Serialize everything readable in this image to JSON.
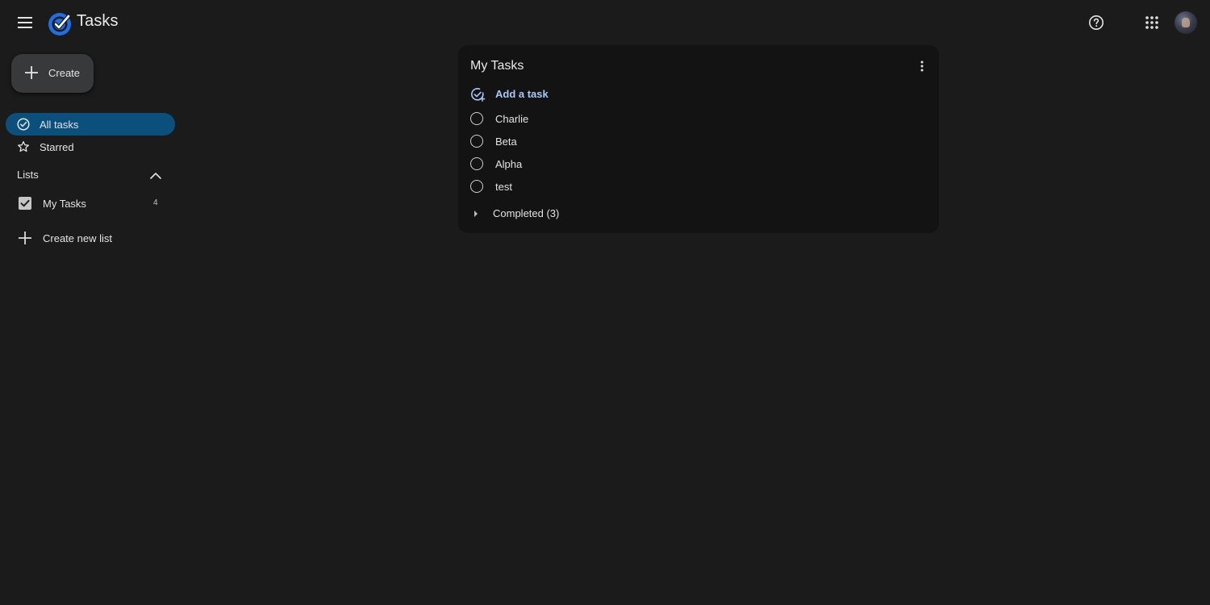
{
  "app": {
    "title": "Tasks",
    "icons": {
      "menu": "hamburger-menu-icon",
      "logo": "tasks-logo-icon",
      "help": "help-circle-icon",
      "apps": "grid-apps-icon",
      "avatar": "user-avatar"
    }
  },
  "sidebar": {
    "create_label": "Create",
    "nav": [
      {
        "label": "All tasks",
        "icon": "check-circle-icon",
        "active": true
      },
      {
        "label": "Starred",
        "icon": "star-outline-icon",
        "active": false
      }
    ],
    "lists_header": "Lists",
    "lists": [
      {
        "label": "My Tasks",
        "count": "4",
        "checked": true
      }
    ],
    "create_list_label": "Create new list"
  },
  "main": {
    "card": {
      "title": "My Tasks",
      "add_task_label": "Add a task",
      "tasks": [
        {
          "label": "Charlie"
        },
        {
          "label": "Beta"
        },
        {
          "label": "Alpha"
        },
        {
          "label": "test"
        }
      ],
      "completed_label": "Completed (3)"
    }
  },
  "colors": {
    "background": "#1b1b1b",
    "card": "#131313",
    "active_nav": "#0b4f7d",
    "accent_text": "#a8c7fa",
    "logo_blue": "#1f6fe5"
  }
}
